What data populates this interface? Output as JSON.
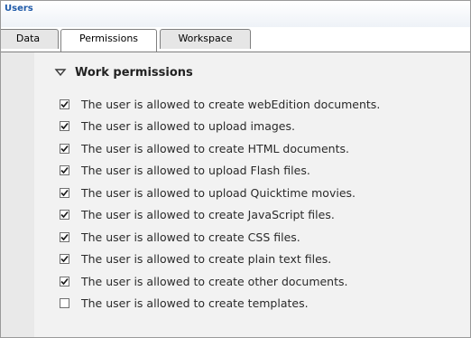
{
  "window": {
    "title": "Users"
  },
  "tabs": [
    {
      "label": "Data",
      "active": false
    },
    {
      "label": "Permissions",
      "active": true
    },
    {
      "label": "Workspace",
      "active": false
    }
  ],
  "section": {
    "title": "Work permissions",
    "expanded": true,
    "toggle_icon": "triangle-down-icon"
  },
  "permissions": [
    {
      "label": "The user is allowed to create webEdition documents.",
      "checked": true
    },
    {
      "label": "The user is allowed to upload images.",
      "checked": true
    },
    {
      "label": "The user is allowed to create HTML documents.",
      "checked": true
    },
    {
      "label": "The user is allowed to upload Flash files.",
      "checked": true
    },
    {
      "label": "The user is allowed to upload Quicktime movies.",
      "checked": true
    },
    {
      "label": "The user is allowed to create JavaScript files.",
      "checked": true
    },
    {
      "label": "The user is allowed to create CSS files.",
      "checked": true
    },
    {
      "label": "The user is allowed to create plain text files.",
      "checked": true
    },
    {
      "label": "The user is allowed to create other documents.",
      "checked": true
    },
    {
      "label": "The user is allowed to create templates.",
      "checked": false
    }
  ],
  "colors": {
    "title_text": "#1f5aa8",
    "panel_left": "#e9e9e9",
    "panel_main": "#f2f2f2",
    "border": "#7f7f7f"
  }
}
